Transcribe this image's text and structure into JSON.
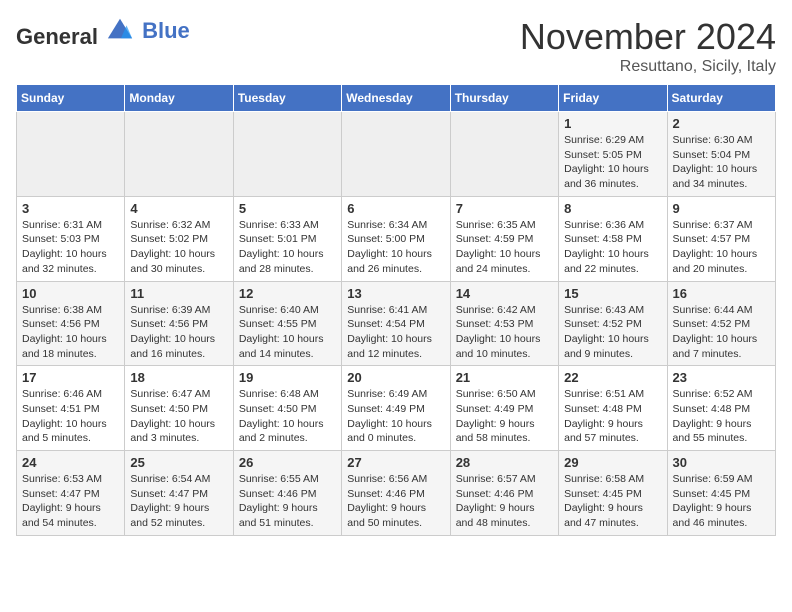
{
  "logo": {
    "general": "General",
    "blue": "Blue"
  },
  "title": "November 2024",
  "location": "Resuttano, Sicily, Italy",
  "weekdays": [
    "Sunday",
    "Monday",
    "Tuesday",
    "Wednesday",
    "Thursday",
    "Friday",
    "Saturday"
  ],
  "weeks": [
    [
      {
        "day": "",
        "info": ""
      },
      {
        "day": "",
        "info": ""
      },
      {
        "day": "",
        "info": ""
      },
      {
        "day": "",
        "info": ""
      },
      {
        "day": "",
        "info": ""
      },
      {
        "day": "1",
        "info": "Sunrise: 6:29 AM\nSunset: 5:05 PM\nDaylight: 10 hours and 36 minutes."
      },
      {
        "day": "2",
        "info": "Sunrise: 6:30 AM\nSunset: 5:04 PM\nDaylight: 10 hours and 34 minutes."
      }
    ],
    [
      {
        "day": "3",
        "info": "Sunrise: 6:31 AM\nSunset: 5:03 PM\nDaylight: 10 hours and 32 minutes."
      },
      {
        "day": "4",
        "info": "Sunrise: 6:32 AM\nSunset: 5:02 PM\nDaylight: 10 hours and 30 minutes."
      },
      {
        "day": "5",
        "info": "Sunrise: 6:33 AM\nSunset: 5:01 PM\nDaylight: 10 hours and 28 minutes."
      },
      {
        "day": "6",
        "info": "Sunrise: 6:34 AM\nSunset: 5:00 PM\nDaylight: 10 hours and 26 minutes."
      },
      {
        "day": "7",
        "info": "Sunrise: 6:35 AM\nSunset: 4:59 PM\nDaylight: 10 hours and 24 minutes."
      },
      {
        "day": "8",
        "info": "Sunrise: 6:36 AM\nSunset: 4:58 PM\nDaylight: 10 hours and 22 minutes."
      },
      {
        "day": "9",
        "info": "Sunrise: 6:37 AM\nSunset: 4:57 PM\nDaylight: 10 hours and 20 minutes."
      }
    ],
    [
      {
        "day": "10",
        "info": "Sunrise: 6:38 AM\nSunset: 4:56 PM\nDaylight: 10 hours and 18 minutes."
      },
      {
        "day": "11",
        "info": "Sunrise: 6:39 AM\nSunset: 4:56 PM\nDaylight: 10 hours and 16 minutes."
      },
      {
        "day": "12",
        "info": "Sunrise: 6:40 AM\nSunset: 4:55 PM\nDaylight: 10 hours and 14 minutes."
      },
      {
        "day": "13",
        "info": "Sunrise: 6:41 AM\nSunset: 4:54 PM\nDaylight: 10 hours and 12 minutes."
      },
      {
        "day": "14",
        "info": "Sunrise: 6:42 AM\nSunset: 4:53 PM\nDaylight: 10 hours and 10 minutes."
      },
      {
        "day": "15",
        "info": "Sunrise: 6:43 AM\nSunset: 4:52 PM\nDaylight: 10 hours and 9 minutes."
      },
      {
        "day": "16",
        "info": "Sunrise: 6:44 AM\nSunset: 4:52 PM\nDaylight: 10 hours and 7 minutes."
      }
    ],
    [
      {
        "day": "17",
        "info": "Sunrise: 6:46 AM\nSunset: 4:51 PM\nDaylight: 10 hours and 5 minutes."
      },
      {
        "day": "18",
        "info": "Sunrise: 6:47 AM\nSunset: 4:50 PM\nDaylight: 10 hours and 3 minutes."
      },
      {
        "day": "19",
        "info": "Sunrise: 6:48 AM\nSunset: 4:50 PM\nDaylight: 10 hours and 2 minutes."
      },
      {
        "day": "20",
        "info": "Sunrise: 6:49 AM\nSunset: 4:49 PM\nDaylight: 10 hours and 0 minutes."
      },
      {
        "day": "21",
        "info": "Sunrise: 6:50 AM\nSunset: 4:49 PM\nDaylight: 9 hours and 58 minutes."
      },
      {
        "day": "22",
        "info": "Sunrise: 6:51 AM\nSunset: 4:48 PM\nDaylight: 9 hours and 57 minutes."
      },
      {
        "day": "23",
        "info": "Sunrise: 6:52 AM\nSunset: 4:48 PM\nDaylight: 9 hours and 55 minutes."
      }
    ],
    [
      {
        "day": "24",
        "info": "Sunrise: 6:53 AM\nSunset: 4:47 PM\nDaylight: 9 hours and 54 minutes."
      },
      {
        "day": "25",
        "info": "Sunrise: 6:54 AM\nSunset: 4:47 PM\nDaylight: 9 hours and 52 minutes."
      },
      {
        "day": "26",
        "info": "Sunrise: 6:55 AM\nSunset: 4:46 PM\nDaylight: 9 hours and 51 minutes."
      },
      {
        "day": "27",
        "info": "Sunrise: 6:56 AM\nSunset: 4:46 PM\nDaylight: 9 hours and 50 minutes."
      },
      {
        "day": "28",
        "info": "Sunrise: 6:57 AM\nSunset: 4:46 PM\nDaylight: 9 hours and 48 minutes."
      },
      {
        "day": "29",
        "info": "Sunrise: 6:58 AM\nSunset: 4:45 PM\nDaylight: 9 hours and 47 minutes."
      },
      {
        "day": "30",
        "info": "Sunrise: 6:59 AM\nSunset: 4:45 PM\nDaylight: 9 hours and 46 minutes."
      }
    ]
  ]
}
